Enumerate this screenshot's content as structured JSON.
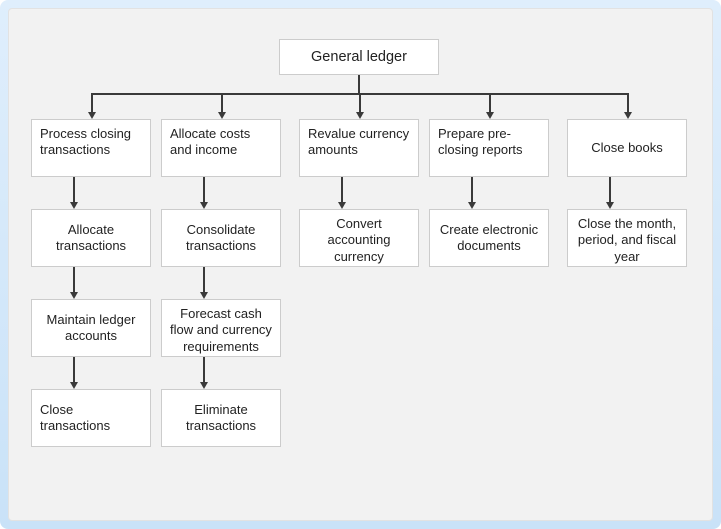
{
  "root": {
    "label": "General ledger"
  },
  "columns": [
    [
      {
        "label": "Process closing transactions"
      },
      {
        "label": "Allocate transactions"
      },
      {
        "label": "Maintain ledger accounts"
      },
      {
        "label": "Close transactions"
      }
    ],
    [
      {
        "label": "Allocate costs and income"
      },
      {
        "label": "Consolidate transactions"
      },
      {
        "label": "Forecast cash flow and currency requirements"
      },
      {
        "label": "Eliminate transactions"
      }
    ],
    [
      {
        "label": "Revalue currency amounts"
      },
      {
        "label": "Convert accounting currency"
      }
    ],
    [
      {
        "label": "Prepare pre-closing reports"
      },
      {
        "label": "Create electronic documents"
      }
    ],
    [
      {
        "label": "Close books"
      },
      {
        "label": "Close the month, period, and fiscal year"
      }
    ]
  ]
}
